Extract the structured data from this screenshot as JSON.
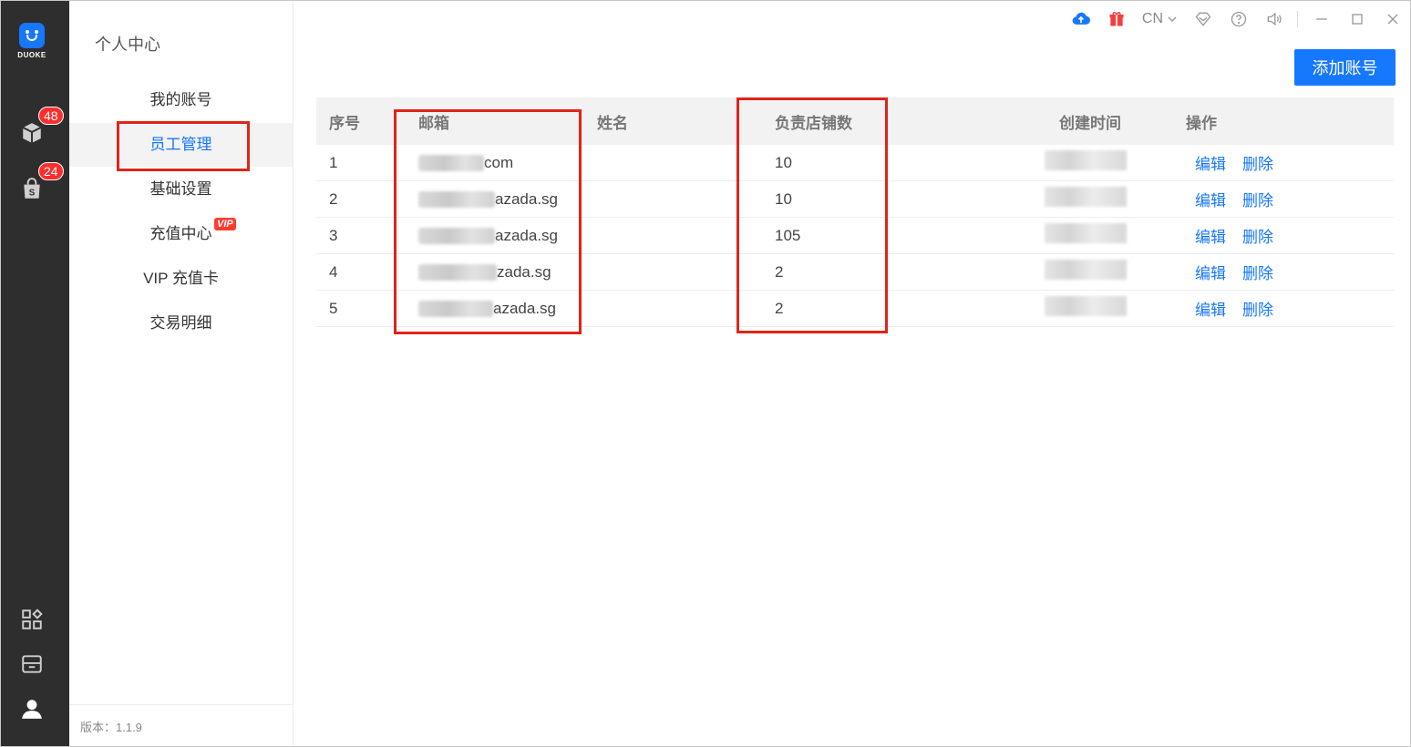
{
  "brand": {
    "logo_text": "DUOKE",
    "accent": "#1677ff",
    "highlight": "#e0241b"
  },
  "rail": {
    "items": [
      {
        "icon": "package-icon",
        "badge": "48"
      },
      {
        "icon": "shopping-bag-icon",
        "badge": "24"
      }
    ],
    "bottom_icons": [
      "apps-grid-icon",
      "store-icon",
      "user-icon"
    ]
  },
  "sidebar": {
    "title": "个人中心",
    "items": [
      {
        "label": "我的账号"
      },
      {
        "label": "员工管理",
        "active": true
      },
      {
        "label": "基础设置"
      },
      {
        "label": "充值中心",
        "tag": "VIP"
      },
      {
        "label": "VIP 充值卡"
      },
      {
        "label": "交易明细"
      }
    ],
    "version": "版本：1.1.9"
  },
  "topbar": {
    "lang": "CN",
    "icons": [
      "upload-cloud-icon",
      "gift-icon",
      "diamond-icon",
      "help-icon",
      "volume-icon",
      "minimize-icon",
      "maximize-icon",
      "close-icon"
    ]
  },
  "main": {
    "add_button": "添加账号",
    "columns": [
      "序号",
      "邮箱",
      "姓名",
      "负责店铺数",
      "创建时间",
      "操作"
    ],
    "rows": [
      {
        "idx": "1",
        "email_suffix": "com",
        "name": "",
        "shops": "10"
      },
      {
        "idx": "2",
        "email_suffix": "azada.sg",
        "name": "",
        "shops": "10"
      },
      {
        "idx": "3",
        "email_suffix": "azada.sg",
        "name": "",
        "shops": "105"
      },
      {
        "idx": "4",
        "email_suffix": "zada.sg",
        "name": "",
        "shops": "2"
      },
      {
        "idx": "5",
        "email_suffix": "azada.sg",
        "name": "",
        "shops": "2"
      }
    ],
    "op_edit": "编辑",
    "op_delete": "删除"
  }
}
